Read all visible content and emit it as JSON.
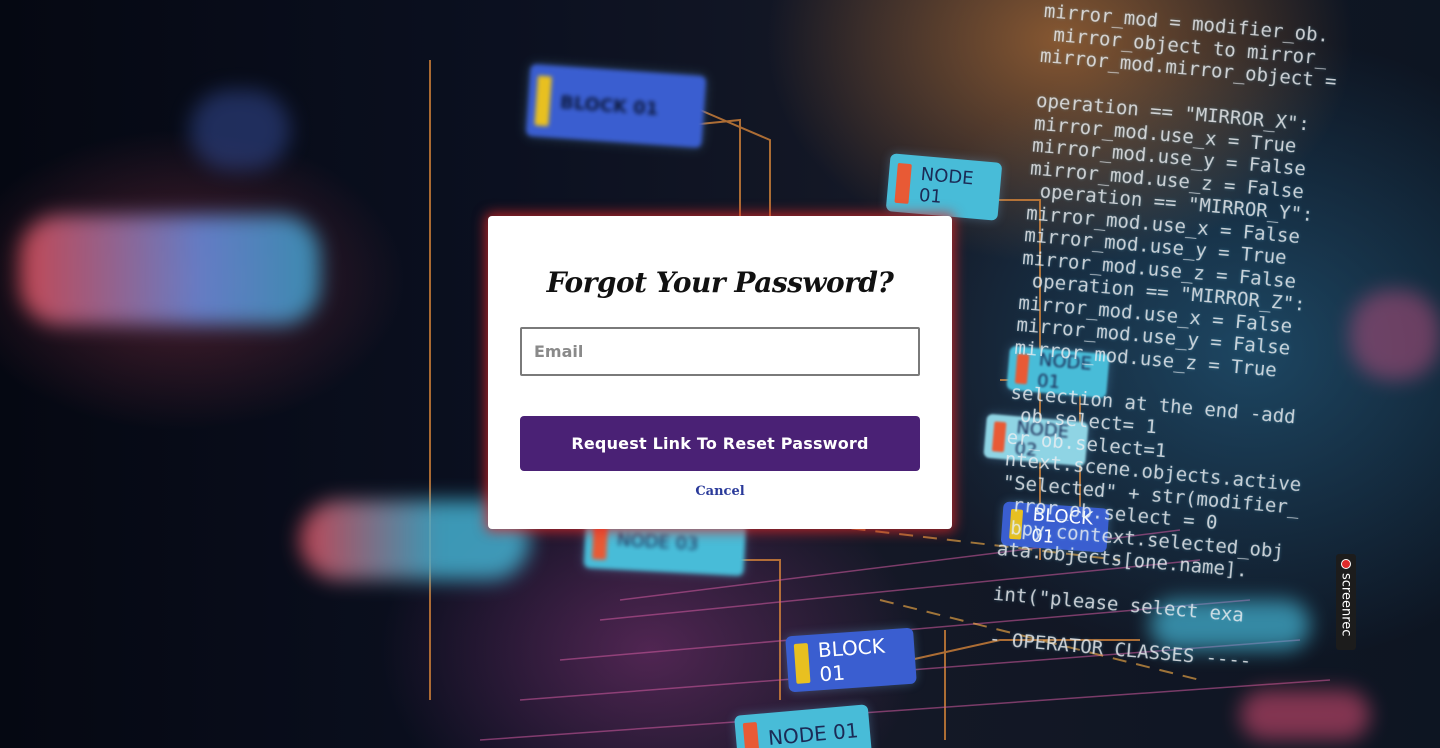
{
  "background": {
    "code_lines": [
      "mirror_mod = modifier_ob.",
      " mirror_object to mirror_",
      "mirror_mod.mirror_object =",
      "",
      "operation == \"MIRROR_X\":",
      "mirror_mod.use_x = True",
      "mirror_mod.use_y = False",
      "mirror_mod.use_z = False",
      " operation == \"MIRROR_Y\":",
      "mirror_mod.use_x = False",
      "mirror_mod.use_y = True",
      "mirror_mod.use_z = False",
      " operation == \"MIRROR_Z\":",
      "mirror_mod.use_x = False",
      "mirror_mod.use_y = False",
      "mirror_mod.use_z = True",
      "",
      "selection at the end -add",
      " ob.select= 1",
      "er_ob.select=1",
      "ntext.scene.objects.active",
      "\"Selected\" + str(modifier_",
      " rror_ob.select = 0",
      " bpy.context.selected_obj",
      "ata.objects[one.name].",
      "",
      "int(\"please select exa",
      "",
      "- OPERATOR CLASSES ----"
    ],
    "chips": {
      "block_top": "BLOCK 01",
      "node_right_top": "NODE 01",
      "node_mid": "NODE 01",
      "node_mid2": "NODE 02",
      "block_mid": "BLOCK 01",
      "node_left": "NODE 03",
      "block_bottom": "BLOCK 01",
      "node_bottom": "NODE 01"
    }
  },
  "modal": {
    "title": "Forgot Your Password?",
    "email_placeholder": "Email",
    "email_value": "",
    "submit_label": "Request Link To Reset Password",
    "cancel_label": "Cancel"
  },
  "overlay": {
    "screenrec_label": "screenrec"
  },
  "colors": {
    "button": "#4a2175",
    "cancel_link": "#2a3a9a",
    "modal_glow": "#dc2828"
  }
}
